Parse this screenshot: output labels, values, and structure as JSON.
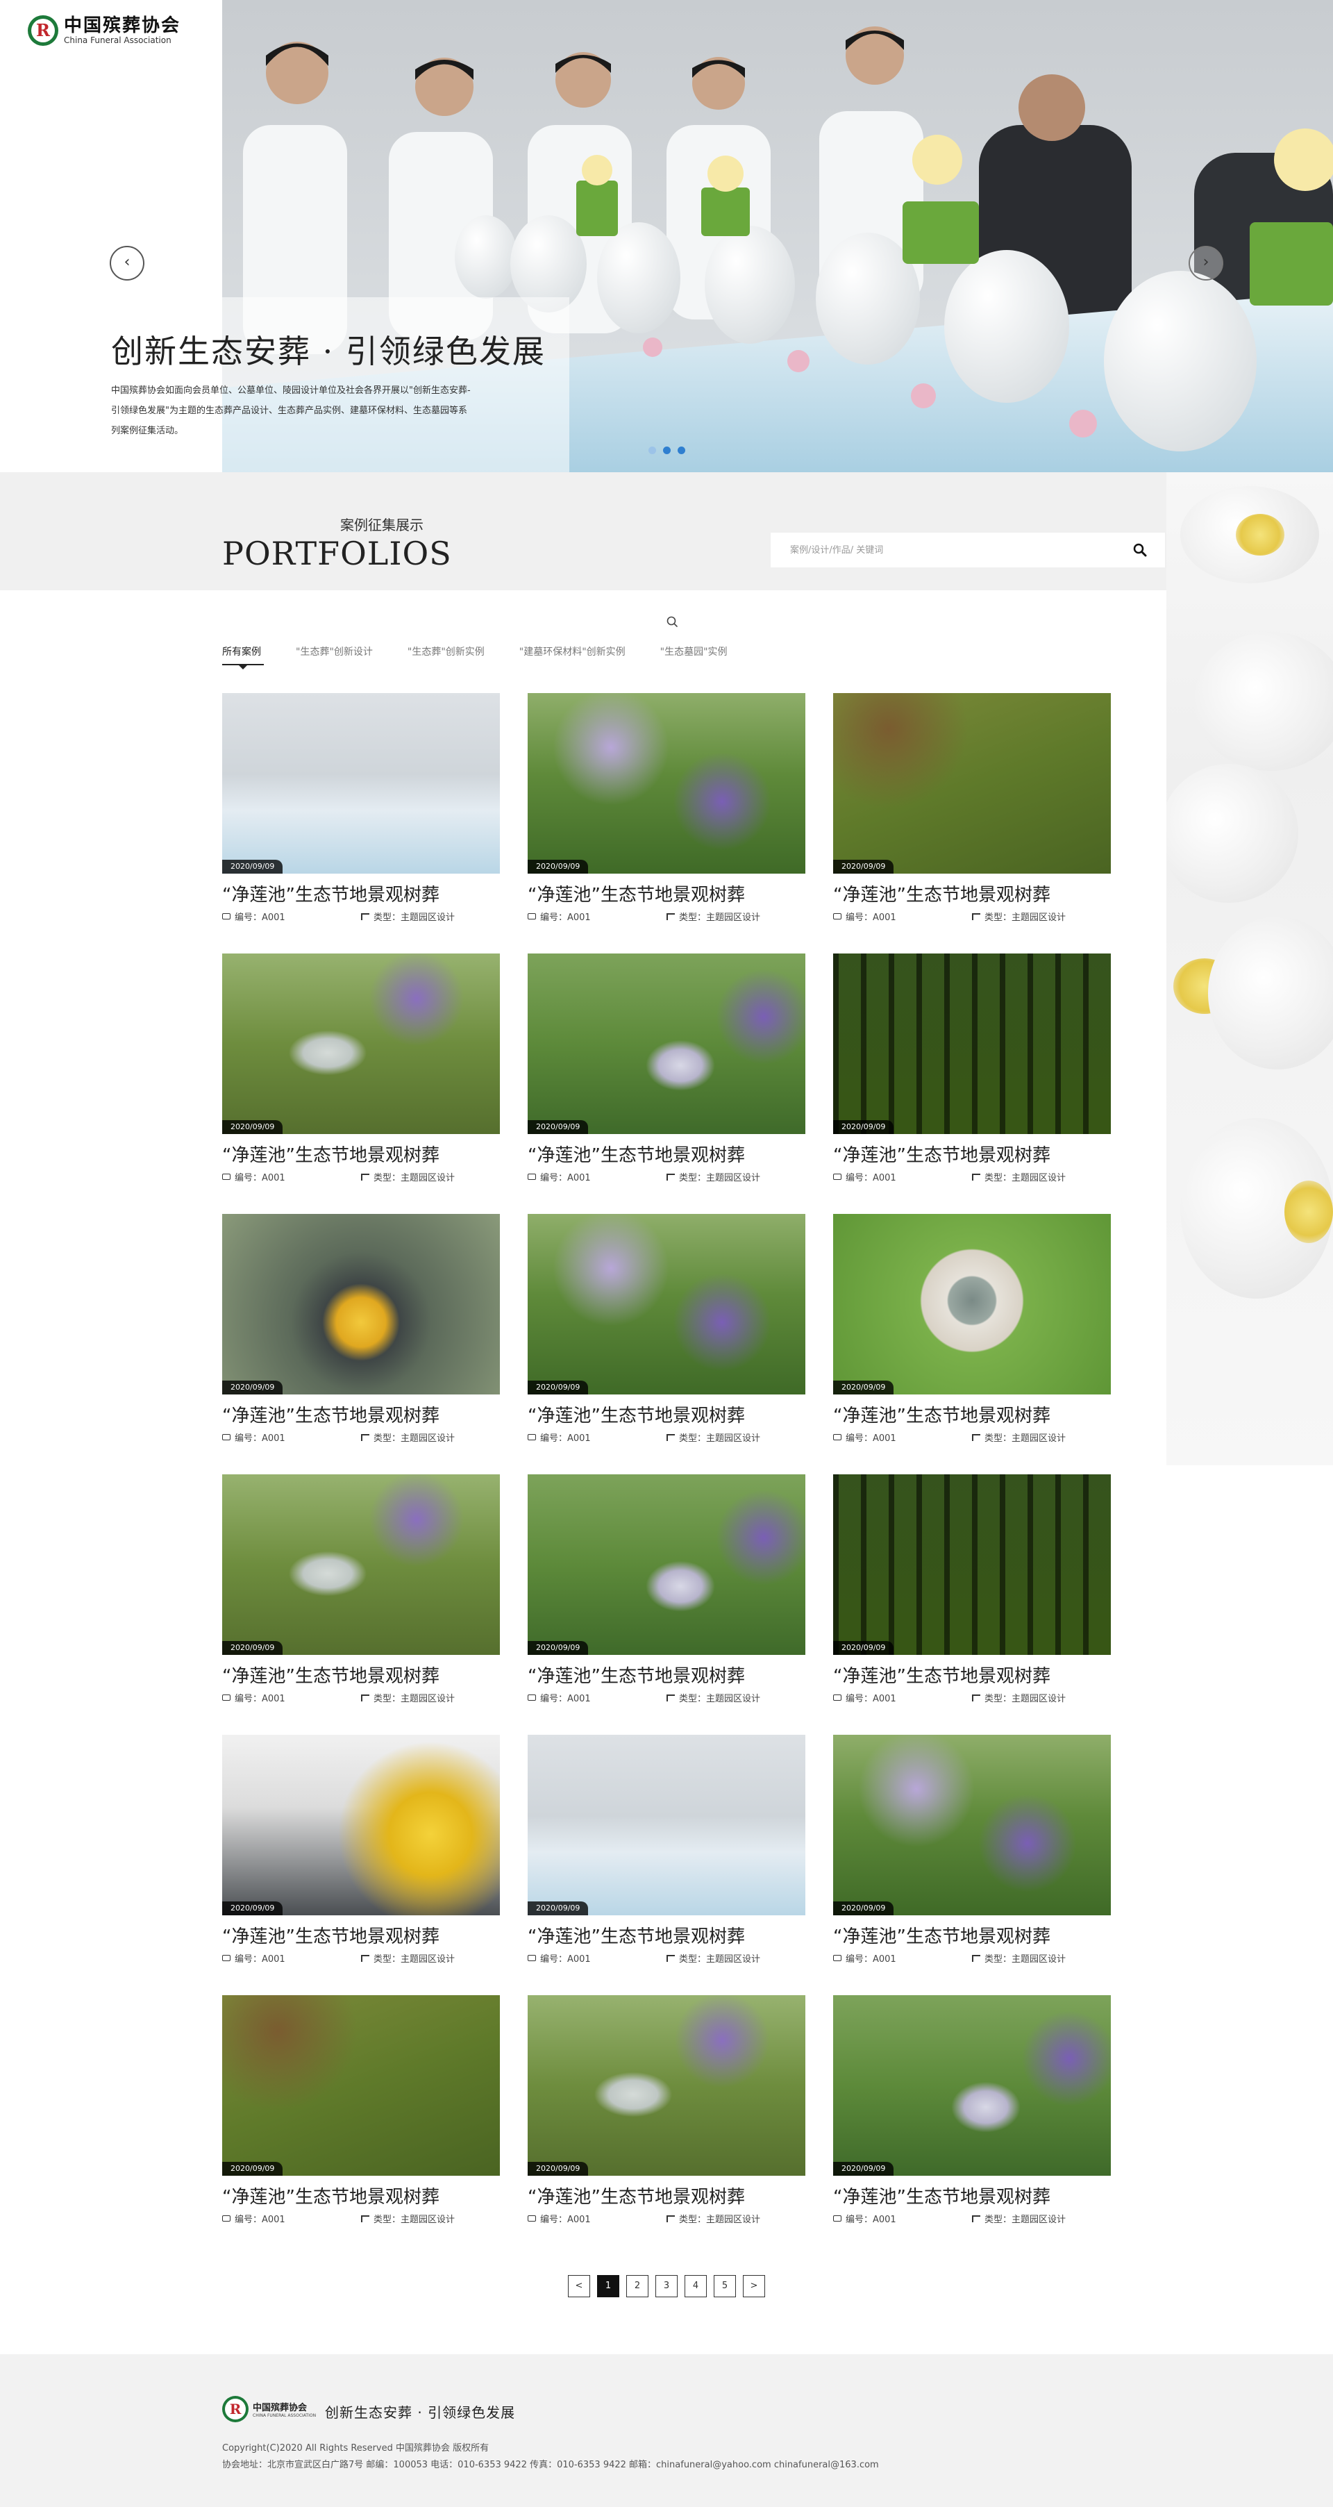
{
  "brand": {
    "name_cn": "中国殡葬协会",
    "name_en": "China Funeral Association",
    "logo_letter": "R",
    "colors": {
      "green": "#1d7a3a",
      "red": "#c2262c"
    }
  },
  "hero": {
    "title": "创新生态安葬 · 引领绿色发展",
    "description": "中国殡葬协会如面向会员单位、公墓单位、陵园设计单位及社会各界开展以\"创新生态安葬-引领绿色发展\"为主题的生态葬产品设计、生态葬产品实例、建墓环保材料、生态墓园等系列案例征集活动。",
    "prev_label": "‹",
    "next_label": "›",
    "slide_count": 3,
    "active_slide": 2
  },
  "portfolio": {
    "subtitle": "案例征集展示",
    "title": "PORTFOLIOS",
    "search_placeholder": "案例/设计/作品/ 关键词"
  },
  "tabs": [
    {
      "label": "所有案例",
      "active": true
    },
    {
      "label": "\"生态葬\"创新设计",
      "active": false
    },
    {
      "label": "\"生态葬\"创新实例",
      "active": false
    },
    {
      "label": "\"建墓环保材料\"创新实例",
      "active": false
    },
    {
      "label": "\"生态墓园\"实例",
      "active": false
    }
  ],
  "cards": [
    {
      "scene": "people",
      "date": "2020/09/09",
      "title": "“净莲池”生态节地景观树葬",
      "code": "编号：A001",
      "type": "类型：主题园区设计"
    },
    {
      "scene": "garden",
      "date": "2020/09/09",
      "title": "“净莲池”生态节地景观树葬",
      "code": "编号：A001",
      "type": "类型：主题园区设计"
    },
    {
      "scene": "grass",
      "date": "2020/09/09",
      "title": "“净莲池”生态节地景观树葬",
      "code": "编号：A001",
      "type": "类型：主题园区设计"
    },
    {
      "scene": "grave",
      "date": "2020/09/09",
      "title": "“净莲池”生态节地景观树葬",
      "code": "编号：A001",
      "type": "类型：主题园区设计"
    },
    {
      "scene": "leaves",
      "date": "2020/09/09",
      "title": "“净莲池”生态节地景观树葬",
      "code": "编号：A001",
      "type": "类型：主题园区设计"
    },
    {
      "scene": "forest",
      "date": "2020/09/09",
      "title": "“净莲池”生态节地景观树葬",
      "code": "编号：A001",
      "type": "类型：主题园区设计"
    },
    {
      "scene": "ceremony",
      "date": "2020/09/09",
      "title": "“净莲池”生态节地景观树葬",
      "code": "编号：A001",
      "type": "类型：主题园区设计"
    },
    {
      "scene": "garden",
      "date": "2020/09/09",
      "title": "“净莲池”生态节地景观树葬",
      "code": "编号：A001",
      "type": "类型：主题园区设计"
    },
    {
      "scene": "circle",
      "date": "2020/09/09",
      "title": "“净莲池”生态节地景观树葬",
      "code": "编号：A001",
      "type": "类型：主题园区设计"
    },
    {
      "scene": "grave",
      "date": "2020/09/09",
      "title": "“净莲池”生态节地景观树葬",
      "code": "编号：A001",
      "type": "类型：主题园区设计"
    },
    {
      "scene": "leaves",
      "date": "2020/09/09",
      "title": "“净莲池”生态节地景观树葬",
      "code": "编号：A001",
      "type": "类型：主题园区设计"
    },
    {
      "scene": "forest",
      "date": "2020/09/09",
      "title": "“净莲池”生态节地景观树葬",
      "code": "编号：A001",
      "type": "类型：主题园区设计"
    },
    {
      "scene": "hands",
      "date": "2020/09/09",
      "title": "“净莲池”生态节地景观树葬",
      "code": "编号：A001",
      "type": "类型：主题园区设计"
    },
    {
      "scene": "people",
      "date": "2020/09/09",
      "title": "“净莲池”生态节地景观树葬",
      "code": "编号：A001",
      "type": "类型：主题园区设计"
    },
    {
      "scene": "garden",
      "date": "2020/09/09",
      "title": "“净莲池”生态节地景观树葬",
      "code": "编号：A001",
      "type": "类型：主题园区设计"
    },
    {
      "scene": "grass",
      "date": "2020/09/09",
      "title": "“净莲池”生态节地景观树葬",
      "code": "编号：A001",
      "type": "类型：主题园区设计"
    },
    {
      "scene": "grave",
      "date": "2020/09/09",
      "title": "“净莲池”生态节地景观树葬",
      "code": "编号：A001",
      "type": "类型：主题园区设计"
    },
    {
      "scene": "leaves",
      "date": "2020/09/09",
      "title": "“净莲池”生态节地景观树葬",
      "code": "编号：A001",
      "type": "类型：主题园区设计"
    }
  ],
  "pagination": {
    "prev": "<",
    "pages": [
      "1",
      "2",
      "3",
      "4",
      "5"
    ],
    "active": "1",
    "next": ">"
  },
  "footer": {
    "logo_cn": "中国殡葬协会",
    "logo_en": "CHINA FUNERAL ASSOCIATION",
    "slogan": "创新生态安葬 · 引领绿色发展",
    "copyright": "Copyright(C)2020 All Rights Reserved 中国殡葬协会 版权所有",
    "address": "协会地址：北京市宣武区白广路7号  邮编：100053  电话：010-6353 9422  传真：010-6353 9422  邮箱：chinafuneral@yahoo.com  chinafuneral@163.com"
  }
}
